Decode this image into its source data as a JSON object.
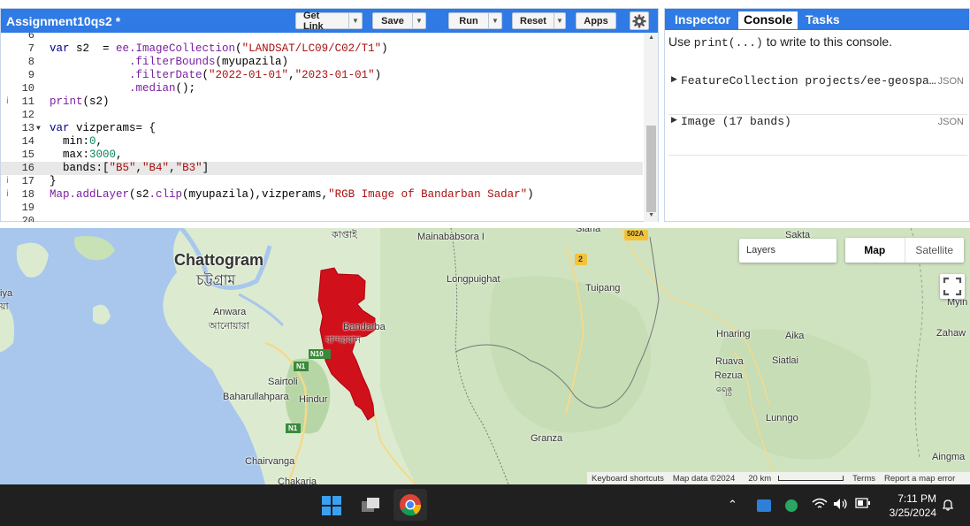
{
  "editor": {
    "script_title": "Assignment10qs2 *",
    "buttons": {
      "get_link": "Get Link",
      "save": "Save",
      "run": "Run",
      "reset": "Reset",
      "apps": "Apps"
    },
    "lines": [
      {
        "num": "6",
        "text": ""
      },
      {
        "num": "7",
        "text": "var s2  = ee.ImageCollection(\"LANDSAT/LC09/C02/T1\")"
      },
      {
        "num": "8",
        "text": "            .filterBounds(myupazila)"
      },
      {
        "num": "9",
        "text": "            .filterDate(\"2022-01-01\",\"2023-01-01\")"
      },
      {
        "num": "10",
        "text": "            .median();"
      },
      {
        "num": "11",
        "text": "print(s2)"
      },
      {
        "num": "12",
        "text": ""
      },
      {
        "num": "13",
        "text": "var vizperams= {"
      },
      {
        "num": "14",
        "text": "  min:0,"
      },
      {
        "num": "15",
        "text": "  max:3000,"
      },
      {
        "num": "16",
        "text": "  bands:[\"B5\",\"B4\",\"B3\"]"
      },
      {
        "num": "17",
        "text": "}"
      },
      {
        "num": "18",
        "text": "Map.addLayer(s2.clip(myupazila),vizperams,\"RGB Image of Bandarban Sadar\")"
      },
      {
        "num": "19",
        "text": ""
      },
      {
        "num": "20",
        "text": ""
      }
    ]
  },
  "right_panel": {
    "tabs": [
      "Inspector",
      "Console",
      "Tasks"
    ],
    "active_tab": "Console",
    "hint_prefix": "Use ",
    "hint_code": "print(...)",
    "hint_suffix": " to write to this console.",
    "entries": [
      {
        "text": "FeatureCollection projects/ee-geospa…",
        "badge": "JSON"
      },
      {
        "text": "Image (17 bands)",
        "badge": "JSON"
      }
    ]
  },
  "map": {
    "layers_label": "Layers",
    "map_type_options": [
      "Map",
      "Satellite"
    ],
    "selected_map_type": "Map",
    "places": [
      {
        "id": "chattogram",
        "text": "Chattogram"
      },
      {
        "id": "chattogram_bn",
        "text": "চট্টগ্রাম"
      },
      {
        "id": "kaptai_bn",
        "text": "কাপ্তাই"
      },
      {
        "id": "mainababsora",
        "text": "Mainababsora I"
      },
      {
        "id": "sialia",
        "text": "Siaha"
      },
      {
        "id": "r502a",
        "text": "502A"
      },
      {
        "id": "sakta",
        "text": "Sakta"
      },
      {
        "id": "r2",
        "text": "2"
      },
      {
        "id": "longpuighat",
        "text": "Longpuighat"
      },
      {
        "id": "tuipang",
        "text": "Tuipang"
      },
      {
        "id": "anwara",
        "text": "Anwara"
      },
      {
        "id": "anwara_bn",
        "text": "আনোয়ারা"
      },
      {
        "id": "bandarban",
        "text": "Bandarba"
      },
      {
        "id": "bandarban_bn",
        "text": "বান্দরবান"
      },
      {
        "id": "n10",
        "text": "N10"
      },
      {
        "id": "n1a",
        "text": "N1"
      },
      {
        "id": "sairtoli",
        "text": "Sairtoli"
      },
      {
        "id": "baharullahpara",
        "text": "Baharullahpara"
      },
      {
        "id": "hindur",
        "text": "Hindur"
      },
      {
        "id": "n1b",
        "text": "N1"
      },
      {
        "id": "chairvanga",
        "text": "Chairvanga"
      },
      {
        "id": "chakaria",
        "text": "Chakaria"
      },
      {
        "id": "granza",
        "text": "Granza"
      },
      {
        "id": "hnaring",
        "text": "Hnaring"
      },
      {
        "id": "aika",
        "text": "Aika"
      },
      {
        "id": "ruava",
        "text": "Ruava"
      },
      {
        "id": "rezua",
        "text": "Rezua"
      },
      {
        "id": "rezua_bn",
        "text": "ရေဇွ"
      },
      {
        "id": "siatlai",
        "text": "Siatlai"
      },
      {
        "id": "lunngo",
        "text": "Lunngo"
      },
      {
        "id": "aingma",
        "text": "Aingma"
      },
      {
        "id": "myin",
        "text": "Myin"
      },
      {
        "id": "zahaw",
        "text": "Zahaw"
      },
      {
        "id": "aiya",
        "text": "iya"
      },
      {
        "id": "aiya2",
        "text": "য়া"
      }
    ],
    "attribution": {
      "shortcuts": "Keyboard shortcuts",
      "map_data": "Map data ©2024",
      "scale": "20 km",
      "terms": "Terms",
      "report": "Report a map error"
    }
  },
  "taskbar": {
    "time": "7:11 PM",
    "date": "3/25/2024"
  },
  "colors": {
    "header_blue": "#2f7ae4",
    "layer_red": "#d0101a",
    "taskbar": "#202020"
  }
}
